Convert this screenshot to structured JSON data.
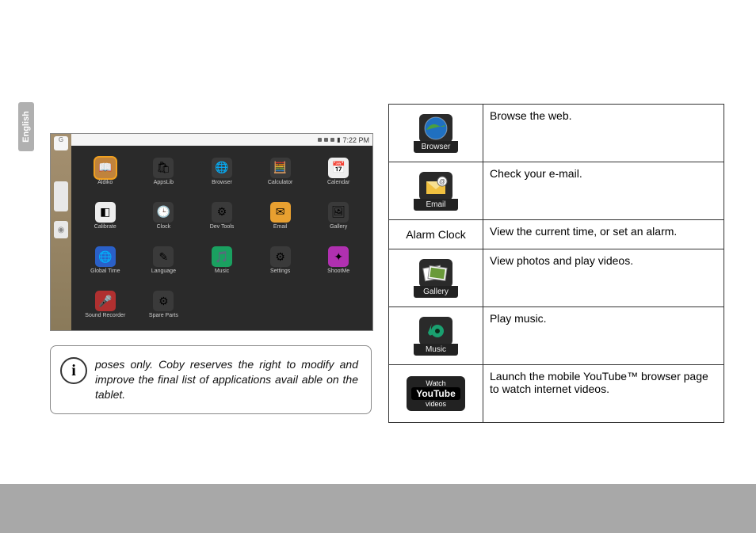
{
  "language_tab": "English",
  "screenshot": {
    "status_time": "7:22 PM",
    "side_text": "G",
    "apps": [
      {
        "name": "Aldiko",
        "color": "#c0833c",
        "glyph": "📖",
        "selected": true
      },
      {
        "name": "AppsLib",
        "color": "#3a3a3a",
        "glyph": "🛍"
      },
      {
        "name": "Browser",
        "color": "#3a3a3a",
        "glyph": "🌐"
      },
      {
        "name": "Calculator",
        "color": "#3a3a3a",
        "glyph": "🧮"
      },
      {
        "name": "Calendar",
        "color": "#eeeeee",
        "glyph": "📅"
      },
      {
        "name": "Calibrate",
        "color": "#eeeeee",
        "glyph": "◧"
      },
      {
        "name": "Clock",
        "color": "#3a3a3a",
        "glyph": "🕒"
      },
      {
        "name": "Dev Tools",
        "color": "#3a3a3a",
        "glyph": "⚙"
      },
      {
        "name": "Email",
        "color": "#e8a030",
        "glyph": "✉"
      },
      {
        "name": "Gallery",
        "color": "#3a3a3a",
        "glyph": "🖼"
      },
      {
        "name": "Global Time",
        "color": "#2a60c8",
        "glyph": "🌐"
      },
      {
        "name": "Language",
        "color": "#3a3a3a",
        "glyph": "✎"
      },
      {
        "name": "Music",
        "color": "#1aa060",
        "glyph": "🎵"
      },
      {
        "name": "Settings",
        "color": "#3a3a3a",
        "glyph": "⚙"
      },
      {
        "name": "ShootMe",
        "color": "#b030b0",
        "glyph": "✦"
      },
      {
        "name": "Sound Recorder",
        "color": "#b03030",
        "glyph": "🎤"
      },
      {
        "name": "Spare Parts",
        "color": "#3a3a3a",
        "glyph": "⚙"
      }
    ]
  },
  "info_note": "poses only. Coby reserves the right to modify and improve the final list of applications avail able on the tablet.",
  "table_rows": [
    {
      "icon_label": "Browser",
      "icon_type": "browser",
      "desc": "Browse the web."
    },
    {
      "icon_label": "Email",
      "icon_type": "email",
      "desc": "Check your e-mail."
    },
    {
      "text_label": "Alarm Clock",
      "desc": "View the current time, or set an alarm."
    },
    {
      "icon_label": "Gallery",
      "icon_type": "gallery",
      "desc": "View photos and play videos."
    },
    {
      "icon_label": "Music",
      "icon_type": "music",
      "desc": "Play music."
    },
    {
      "icon_label_top": "Watch",
      "icon_label_mid": "YouTube",
      "icon_label_bot": "videos",
      "icon_type": "youtube",
      "desc": "Launch the mobile YouTube™ browser page to watch internet videos."
    }
  ]
}
